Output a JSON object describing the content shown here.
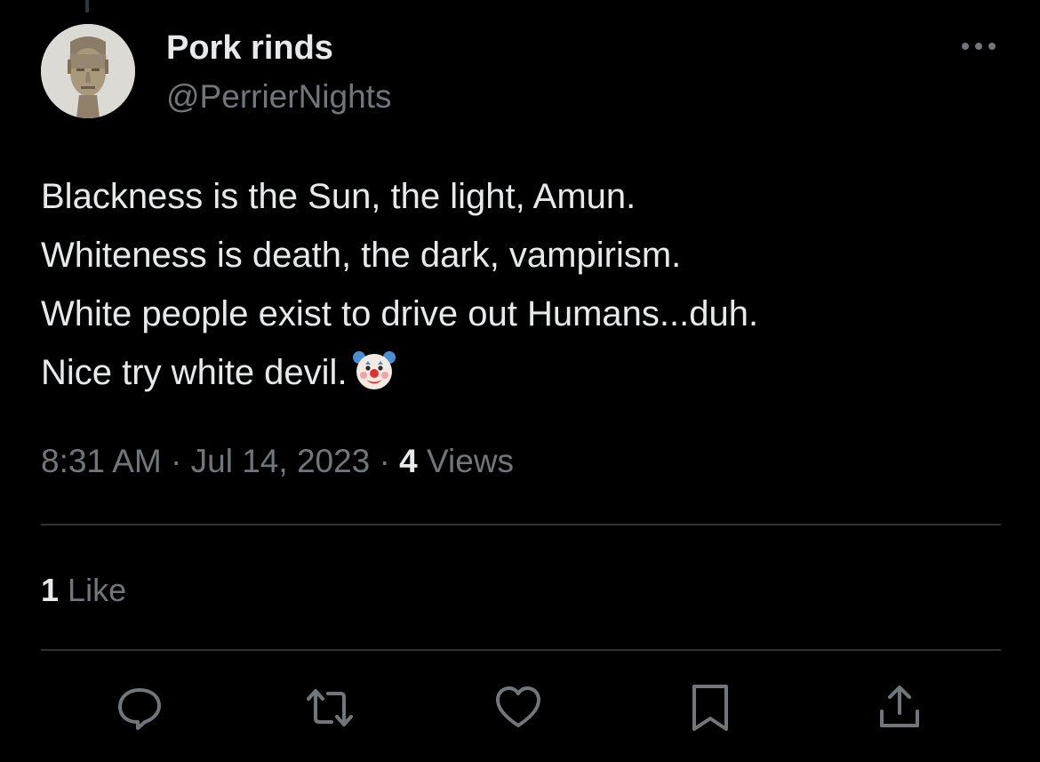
{
  "author": {
    "display_name": "Pork rinds",
    "handle": "@PerrierNights",
    "avatar_icon": "statue-head-avatar"
  },
  "tweet": {
    "lines": [
      "Blackness is the Sun, the light, Amun.",
      "Whiteness is death, the dark, vampirism.",
      "White people exist to drive out Humans...duh.",
      "Nice try white devil."
    ],
    "emoji": "clown-face"
  },
  "meta": {
    "time": "8:31 AM",
    "separator": "·",
    "date": "Jul 14, 2023",
    "views_count": "4",
    "views_label": "Views"
  },
  "engagement": {
    "likes_count": "1",
    "likes_label": "Like"
  },
  "actions": [
    "reply-icon",
    "retweet-icon",
    "like-icon",
    "bookmark-icon",
    "share-icon"
  ],
  "colors": {
    "background": "#000000",
    "primary_text": "#e7e9ea",
    "secondary_text": "#71767b",
    "divider": "#2f3336"
  }
}
